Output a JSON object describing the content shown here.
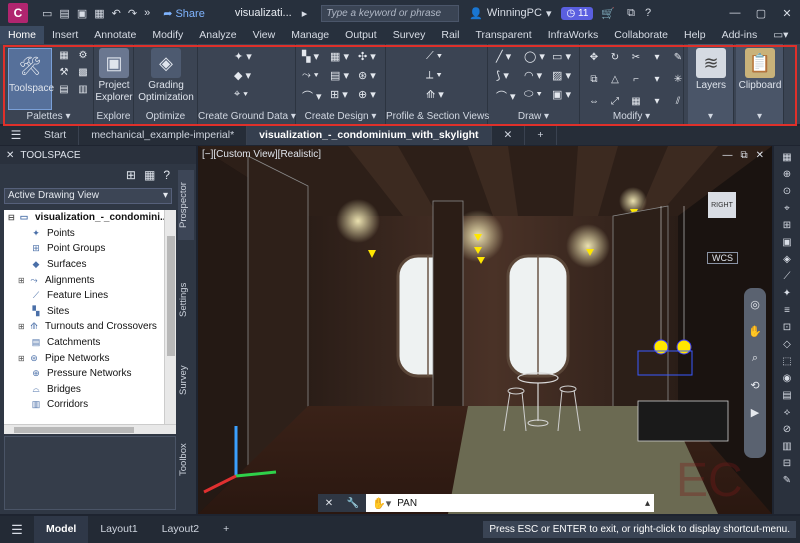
{
  "titlebar": {
    "app_letter": "C",
    "share_label": "Share",
    "title": "visualizati...",
    "search_placeholder": "Type a keyword or phrase",
    "user": "WinningPC",
    "badge": "11",
    "help": "?"
  },
  "menubar": {
    "items": [
      "Home",
      "Insert",
      "Annotate",
      "Modify",
      "Analyze",
      "View",
      "Manage",
      "Output",
      "Survey",
      "Rail",
      "Transparent",
      "InfraWorks",
      "Collaborate",
      "Help",
      "Add-ins"
    ]
  },
  "ribbon": {
    "palettes": {
      "toolspace_label": "Toolspace",
      "panel_label": "Palettes ▾"
    },
    "explore": {
      "project_explorer_line1": "Project",
      "project_explorer_line2": "Explorer",
      "panel_label": "Explore"
    },
    "optimize": {
      "grading_line1": "Grading",
      "grading_line2": "Optimization",
      "panel_label": "Optimize"
    },
    "ground": {
      "panel_label": "Create Ground Data ▾"
    },
    "design": {
      "panel_label": "Create Design ▾"
    },
    "profile": {
      "panel_label": "Profile & Section Views"
    },
    "draw": {
      "panel_label": "Draw ▾"
    },
    "modify": {
      "panel_label": "Modify ▾"
    },
    "layers": {
      "label": "Layers"
    },
    "clipboard": {
      "label": "Clipboard"
    }
  },
  "doc_tabs": {
    "start": "Start",
    "tab1": "mechanical_example-imperial*",
    "tab2": "visualization_-_condominium_with_skylight",
    "add": "+"
  },
  "toolspace": {
    "header": "TOOLSPACE",
    "view_select": "Active Drawing View",
    "root": "visualization_-_condomini...",
    "items": [
      "Points",
      "Point Groups",
      "Surfaces",
      "Alignments",
      "Feature Lines",
      "Sites",
      "Turnouts and Crossovers",
      "Catchments",
      "Pipe Networks",
      "Pressure Networks",
      "Bridges",
      "Corridors"
    ],
    "vertical_tabs": [
      "Prospector",
      "Settings",
      "Survey",
      "Toolbox"
    ]
  },
  "viewport": {
    "label": "[−][Custom View][Realistic]",
    "cube_face": "RIGHT",
    "wcs": "WCS",
    "command_text": "PAN"
  },
  "statusbar": {
    "tabs": [
      "Model",
      "Layout1",
      "Layout2"
    ],
    "add": "+",
    "message": "Press ESC or ENTER to exit, or right-click to display shortcut-menu."
  },
  "colors": {
    "accent": "#5a5fe0",
    "highlight_border": "#e0302a",
    "brand": "#b0256f"
  }
}
